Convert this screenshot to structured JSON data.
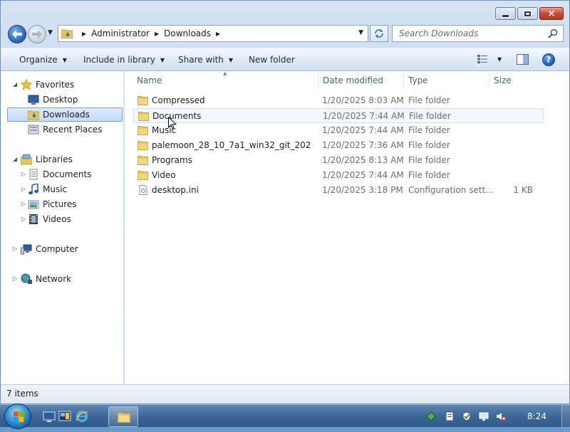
{
  "window": {
    "caption": {
      "minimize": "minimize",
      "maximize": "maximize",
      "close": "×"
    }
  },
  "address": {
    "crumbs": [
      "Administrator",
      "Downloads"
    ]
  },
  "search": {
    "placeholder": "Search Downloads"
  },
  "command_bar": {
    "organize": "Organize",
    "include_in_library": "Include in library",
    "share_with": "Share with",
    "new_folder": "New folder",
    "help": "?"
  },
  "navigation": {
    "favorites": {
      "label": "Favorites",
      "items": [
        {
          "label": "Desktop",
          "icon": "desktop-icon"
        },
        {
          "label": "Downloads",
          "icon": "downloads-folder-icon",
          "selected": true
        },
        {
          "label": "Recent Places",
          "icon": "recent-places-icon"
        }
      ]
    },
    "libraries": {
      "label": "Libraries",
      "items": [
        {
          "label": "Documents",
          "icon": "documents-icon"
        },
        {
          "label": "Music",
          "icon": "music-icon"
        },
        {
          "label": "Pictures",
          "icon": "pictures-icon"
        },
        {
          "label": "Videos",
          "icon": "videos-icon"
        }
      ]
    },
    "computer": {
      "label": "Computer"
    },
    "network": {
      "label": "Network"
    }
  },
  "file_list": {
    "columns": {
      "name": "Name",
      "date_modified": "Date modified",
      "type": "Type",
      "size": "Size"
    },
    "rows": [
      {
        "name": "Compressed",
        "date": "1/20/2025 8:03 AM",
        "type": "File folder",
        "size": "",
        "icon": "folder-icon"
      },
      {
        "name": "Documents",
        "date": "1/20/2025 7:44 AM",
        "type": "File folder",
        "size": "",
        "icon": "folder-icon",
        "hover": true
      },
      {
        "name": "Music",
        "date": "1/20/2025 7:44 AM",
        "type": "File folder",
        "size": "",
        "icon": "folder-icon"
      },
      {
        "name": "palemoon_28_10_7a1_win32_git_202",
        "date": "1/20/2025 7:36 AM",
        "type": "File folder",
        "size": "",
        "icon": "folder-icon"
      },
      {
        "name": "Programs",
        "date": "1/20/2025 8:13 AM",
        "type": "File folder",
        "size": "",
        "icon": "folder-icon"
      },
      {
        "name": "Video",
        "date": "1/20/2025 7:44 AM",
        "type": "File folder",
        "size": "",
        "icon": "folder-icon"
      },
      {
        "name": "desktop.ini",
        "date": "1/20/2025 3:18 PM",
        "type": "Configuration sett...",
        "size": "1 KB",
        "icon": "ini-file-icon"
      }
    ]
  },
  "status": {
    "item_count": "7 items"
  },
  "taskbar": {
    "clock": "8:24",
    "pinned": [
      "show-desktop-icon",
      "explorer-pinned-icon",
      "internet-explorer-icon"
    ],
    "active_window": "windows-explorer-icon",
    "tray": [
      "network-tray-icon",
      "document-tray-icon",
      "security-tray-icon",
      "display-tray-icon",
      "volume-muted-icon"
    ]
  },
  "colors": {
    "selection_bg": "#c1dcfb",
    "selection_border": "#7da2ce",
    "column_header": "#4c607a",
    "secondary_text": "#6d6d6d",
    "folder_yellow": "#e8c65a",
    "taskbar": "#3d6796"
  }
}
